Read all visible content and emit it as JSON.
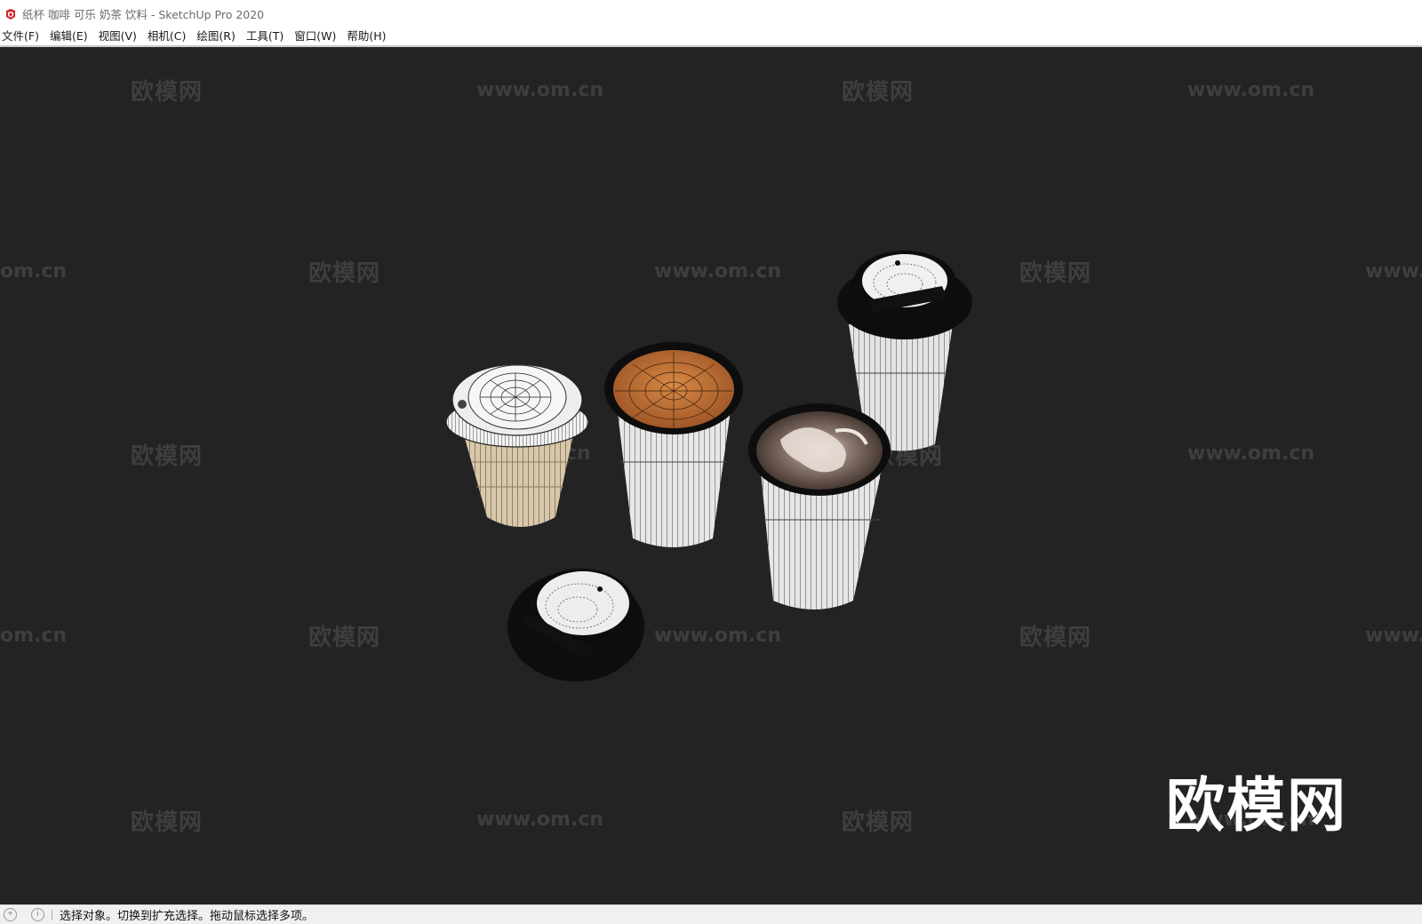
{
  "window": {
    "title": "纸杯 咖啡 可乐 奶茶 饮料 - SketchUp Pro 2020",
    "icon": "sketchup-logo-icon"
  },
  "menu": {
    "items": [
      {
        "label": "文件(F)"
      },
      {
        "label": "编辑(E)"
      },
      {
        "label": "视图(V)"
      },
      {
        "label": "相机(C)"
      },
      {
        "label": "绘图(R)"
      },
      {
        "label": "工具(T)"
      },
      {
        "label": "窗口(W)"
      },
      {
        "label": "帮助(H)"
      }
    ]
  },
  "watermarks": {
    "brand": "欧模网",
    "url": "www.om.cn",
    "url_partial_left": "om.cn",
    "url_partial_right": "www.",
    "url_partial_mid": "cn",
    "logo": "欧模网"
  },
  "statusbar": {
    "icons": [
      "location-icon",
      "info-icon"
    ],
    "text": "选择对象。切换到扩充选择。拖动鼠标选择多项。"
  },
  "colors": {
    "viewport_bg": "#232323",
    "watermark": "#3e3e3e",
    "cup_paper": "#e8e4e2",
    "cup_kraft": "#d8c8a8",
    "coffee": "#c97a3a",
    "latte": "#7a6a62",
    "lid_black": "#0d0d0d"
  }
}
